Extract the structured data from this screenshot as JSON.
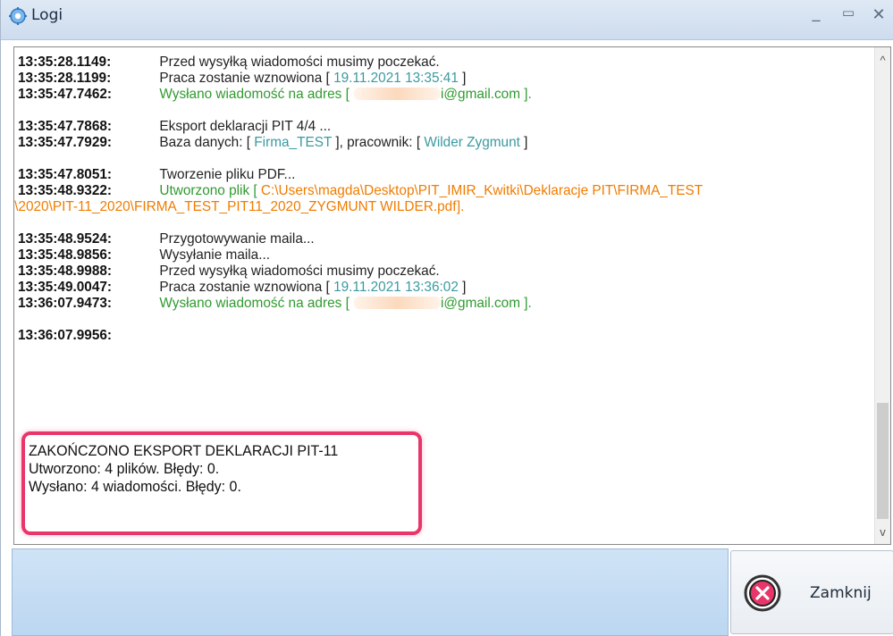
{
  "window": {
    "title": "Logi"
  },
  "log": {
    "groups": [
      [
        {
          "ts": "13:35:28.1149:",
          "parts": [
            {
              "t": "Przed wysyłką wiadomości musimy poczekać.",
              "c": "txt"
            }
          ]
        },
        {
          "ts": "13:35:28.1199:",
          "parts": [
            {
              "t": "Praca zostanie wznowiona [ ",
              "c": "txt"
            },
            {
              "t": "19.11.2021 13:35:41",
              "c": "teal"
            },
            {
              "t": " ]",
              "c": "txt"
            }
          ]
        },
        {
          "ts": "13:35:47.7462:",
          "parts": [
            {
              "t": "Wysłano wiadomość na adres [ ",
              "c": "green"
            },
            {
              "t": "",
              "c": "redact"
            },
            {
              "t": "i@gmail.com ].",
              "c": "green"
            }
          ]
        }
      ],
      [
        {
          "ts": "13:35:47.7868:",
          "parts": [
            {
              "t": "Eksport deklaracji PIT 4/4 ...",
              "c": "txt"
            }
          ]
        },
        {
          "ts": "13:35:47.7929:",
          "parts": [
            {
              "t": "Baza danych: [ ",
              "c": "txt"
            },
            {
              "t": "Firma_TEST",
              "c": "teal"
            },
            {
              "t": " ], pracownik: [ ",
              "c": "txt"
            },
            {
              "t": "Wilder Zygmunt",
              "c": "teal"
            },
            {
              "t": " ]",
              "c": "txt"
            }
          ]
        }
      ],
      [
        {
          "ts": "13:35:47.8051:",
          "parts": [
            {
              "t": "Tworzenie pliku PDF...",
              "c": "txt"
            }
          ]
        },
        {
          "ts": "13:35:48.9322:",
          "parts": [
            {
              "t": "Utworzono plik [ ",
              "c": "green"
            },
            {
              "t": "C:\\Users\\magda\\Desktop\\PIT_IMIR_Kwitki\\Deklaracje PIT\\FIRMA_TEST",
              "c": "orange"
            }
          ]
        },
        {
          "ts": "",
          "parts": [
            {
              "t": "\\2020\\PIT-11_2020\\FIRMA_TEST_PIT11_2020_ZYGMUNT WILDER.pdf",
              "c": "orange"
            },
            {
              "t": " ].",
              "c": "green"
            }
          ]
        }
      ],
      [
        {
          "ts": "13:35:48.9524:",
          "parts": [
            {
              "t": "Przygotowywanie maila...",
              "c": "txt"
            }
          ]
        },
        {
          "ts": "13:35:48.9856:",
          "parts": [
            {
              "t": "Wysyłanie maila...",
              "c": "txt"
            }
          ]
        },
        {
          "ts": "13:35:48.9988:",
          "parts": [
            {
              "t": "Przed wysyłką wiadomości musimy poczekać.",
              "c": "txt"
            }
          ]
        },
        {
          "ts": "13:35:49.0047:",
          "parts": [
            {
              "t": "Praca zostanie wznowiona [ ",
              "c": "txt"
            },
            {
              "t": "19.11.2021 13:36:02",
              "c": "teal"
            },
            {
              "t": " ]",
              "c": "txt"
            }
          ]
        },
        {
          "ts": "13:36:07.9473:",
          "parts": [
            {
              "t": "Wysłano wiadomość na adres [ ",
              "c": "green"
            },
            {
              "t": "",
              "c": "redact"
            },
            {
              "t": "i@gmail.com ].",
              "c": "green"
            }
          ]
        }
      ],
      [
        {
          "ts": "13:36:07.9956:",
          "parts": []
        }
      ]
    ],
    "summary": [
      "ZAKOŃCZONO EKSPORT DEKLARACJI PIT-11",
      "Utworzono: 4 plików. Błędy: 0.",
      "Wysłano: 4 wiadomości. Błędy: 0."
    ]
  },
  "footer": {
    "close_label": "Zamknij"
  },
  "colors": {
    "accent_highlight": "#e8366a",
    "green_text": "#2f9a2f",
    "teal_text": "#3b9aa0",
    "orange_text": "#f07c00"
  },
  "icons": {
    "app": "gear-icon",
    "close": "close-circle-icon"
  }
}
